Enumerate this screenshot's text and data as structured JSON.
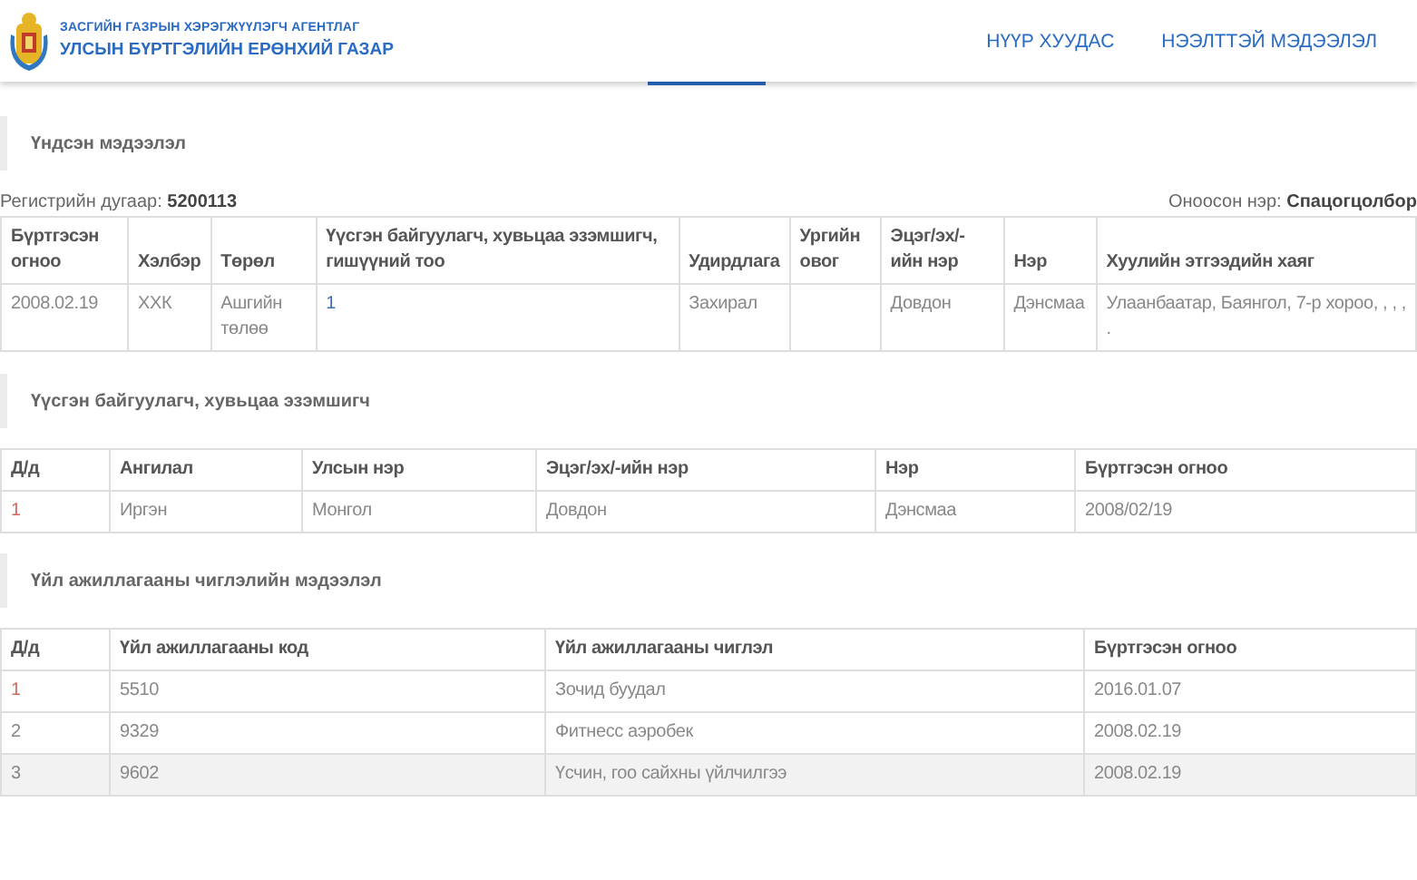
{
  "header": {
    "agency": "ЗАСГИЙН ГАЗРЫН ХЭРЭГЖҮҮЛЭГЧ АГЕНТЛАГ",
    "title": "УЛСЫН БҮРТГЭЛИЙН ЕРӨНХИЙ ГАЗАР",
    "nav": [
      {
        "label": "НҮҮР ХУУДАС"
      },
      {
        "label": "НЭЭЛТТЭЙ МЭДЭЭЛЭЛ"
      }
    ]
  },
  "basic": {
    "heading": "Үндсэн мэдээлэл",
    "reg_label": "Регистрийн дугаар:",
    "reg_value": "5200113",
    "name_label": "Оноосон нэр:",
    "name_value": "Спацогцолбор",
    "columns": [
      "Бүртгэсэн огноо",
      "Хэлбэр",
      "Төрөл",
      "Үүсгэн байгуулагч, хувьцаа эзэмшигч, гишүүний тоо",
      "Удирдлага",
      "Ургийн овог",
      "Эцэг/эх/-ийн нэр",
      "Нэр",
      "Хуулийн этгээдийн хаяг"
    ],
    "rows": [
      {
        "highlighted": false,
        "cells": [
          "2008.02.19",
          "ХХК",
          "Ашгийн төлөө",
          {
            "text": "1",
            "color": "#3d6fb6"
          },
          "Захирал",
          "",
          "Довдон",
          "Дэнсмаа",
          "Улаанбаатар, Баянгол, 7-р хороо, , , , ."
        ]
      }
    ]
  },
  "founders": {
    "heading": "Үүсгэн байгуулагч, хувьцаа эзэмшигч",
    "columns": [
      "Д/д",
      "Ангилал",
      "Улсын нэр",
      "Эцэг/эх/-ийн нэр",
      "Нэр",
      "Бүртгэсэн огноо"
    ],
    "rows": [
      {
        "highlighted": false,
        "cells": [
          {
            "text": "1",
            "color": "#cf6b5c"
          },
          "Иргэн",
          "Монгол",
          "Довдон",
          "Дэнсмаа",
          "2008/02/19"
        ]
      }
    ]
  },
  "activities": {
    "heading": "Үйл ажиллагааны чиглэлийн мэдээлэл",
    "columns": [
      "Д/д",
      "Үйл ажиллагааны код",
      "Үйл ажиллагааны чиглэл",
      "Бүртгэсэн огноо"
    ],
    "rows": [
      {
        "highlighted": false,
        "cells": [
          {
            "text": "1",
            "color": "#cf6b5c"
          },
          "5510",
          "Зочид буудал",
          "2016.01.07"
        ]
      },
      {
        "highlighted": false,
        "cells": [
          "2",
          "9329",
          "Фитнесс аэробек",
          "2008.02.19"
        ]
      },
      {
        "highlighted": true,
        "cells": [
          "3",
          "9602",
          "Үсчин, гоо сайхны үйлчилгээ",
          "2008.02.19"
        ]
      }
    ]
  }
}
